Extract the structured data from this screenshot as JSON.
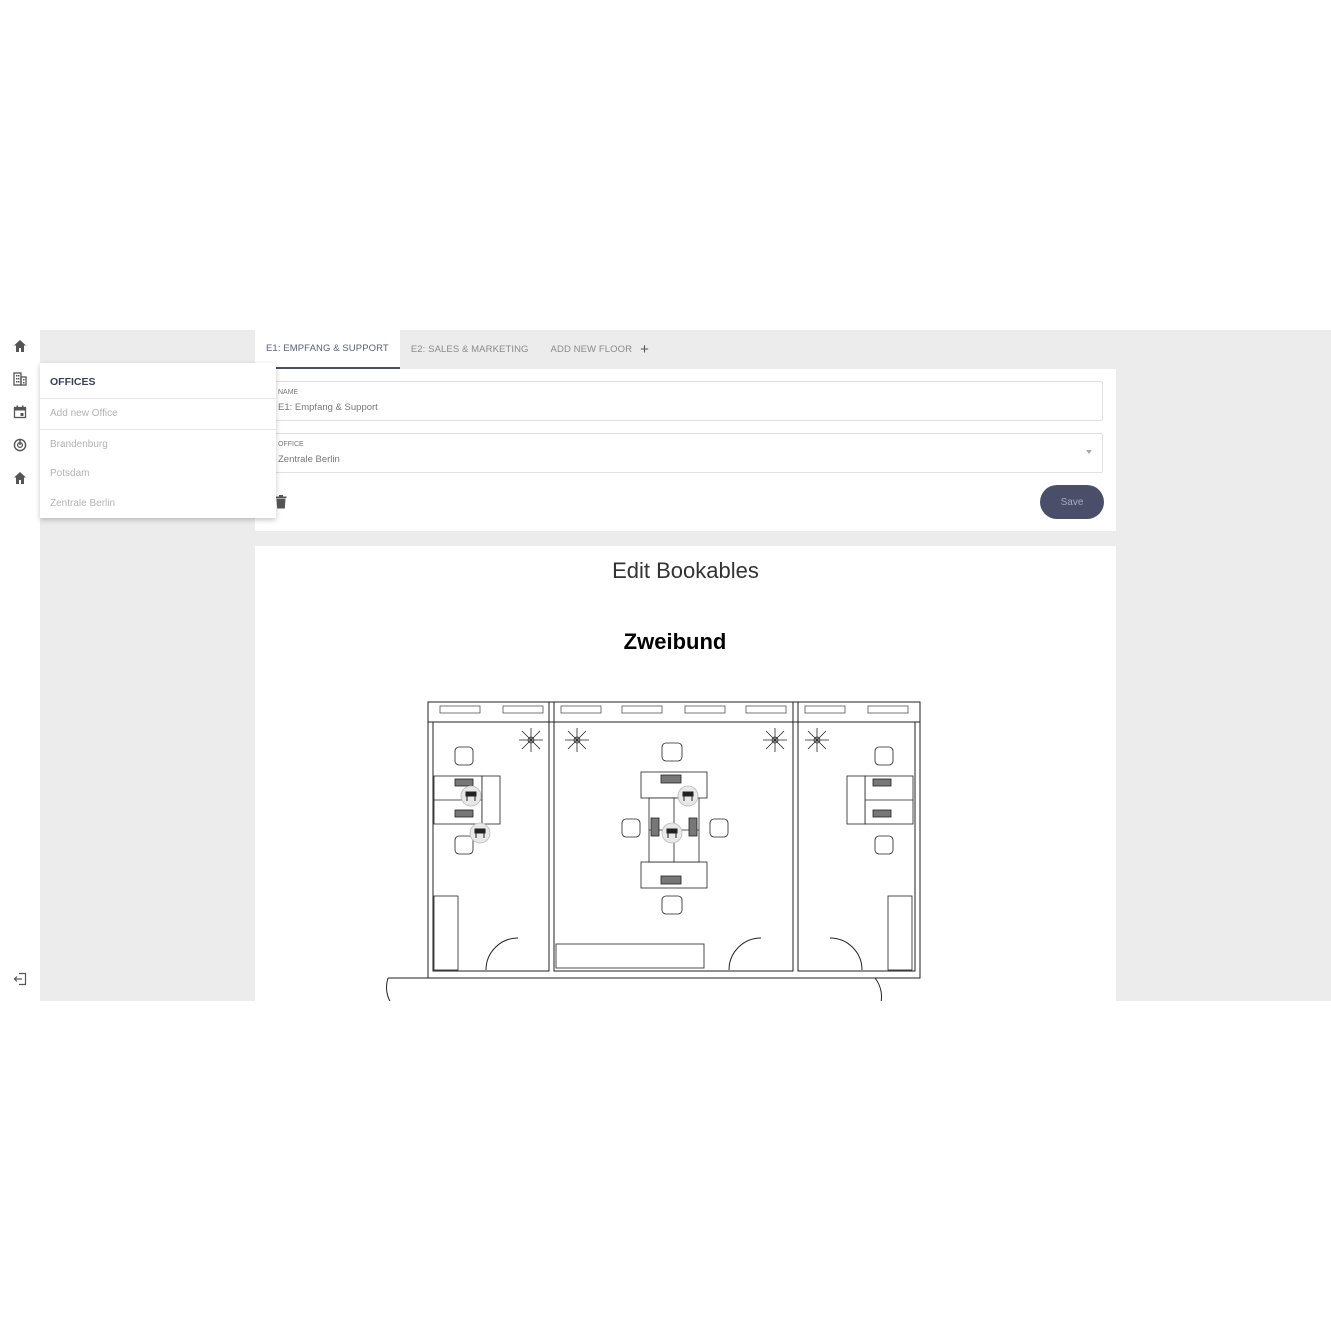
{
  "sidebar": {
    "items": [
      {
        "icon": "home-icon"
      },
      {
        "icon": "office-building-icon"
      },
      {
        "icon": "calendar-icon"
      },
      {
        "icon": "dashboard-gauge-icon"
      },
      {
        "icon": "home-icon"
      }
    ],
    "logout_icon": "logout-icon"
  },
  "tabs": [
    {
      "label": "E1: EMPFANG & SUPPORT",
      "active": true
    },
    {
      "label": "E2: SALES & MARKETING",
      "active": false
    },
    {
      "label": "ADD NEW FLOOR",
      "active": false
    }
  ],
  "floor_form": {
    "name_label": "NAME",
    "name_value": "E1: Empfang  & Support",
    "office_label": "OFFICE",
    "office_value": "Zentrale Berlin",
    "save_label": "Save"
  },
  "bookables": {
    "title": "Edit Bookables",
    "plan_title": "Zweibund"
  },
  "offices_menu": {
    "title": "OFFICES",
    "add_label": "Add new Office",
    "items": [
      "Brandenburg",
      "Potsdam",
      "Zentrale Berlin"
    ]
  },
  "colors": {
    "accent": "#4a4e69",
    "background": "#ececec"
  }
}
